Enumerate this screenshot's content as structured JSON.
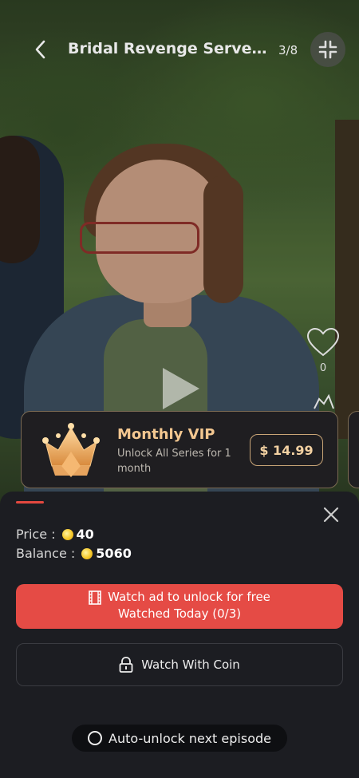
{
  "header": {
    "title": "Bridal Revenge Served ...",
    "episode_counter": "3/8"
  },
  "actions": {
    "like_count": "0"
  },
  "vip": {
    "title": "Monthly VIP",
    "description": "Unlock All Series for 1 month",
    "price": "$ 14.99"
  },
  "unlock": {
    "price_label": "Price :",
    "price_value": "40",
    "balance_label": "Balance :",
    "balance_value": "5060",
    "ad_button_line1": "Watch ad  to unlock for free",
    "ad_button_line2": "Watched Today  (0/3)",
    "coin_button": "Watch With Coin",
    "auto_unlock": "Auto-unlock next episode"
  },
  "colors": {
    "accent_red": "#e54b45",
    "vip_gold": "#f3c790",
    "sheet_bg": "#1c1d22"
  }
}
